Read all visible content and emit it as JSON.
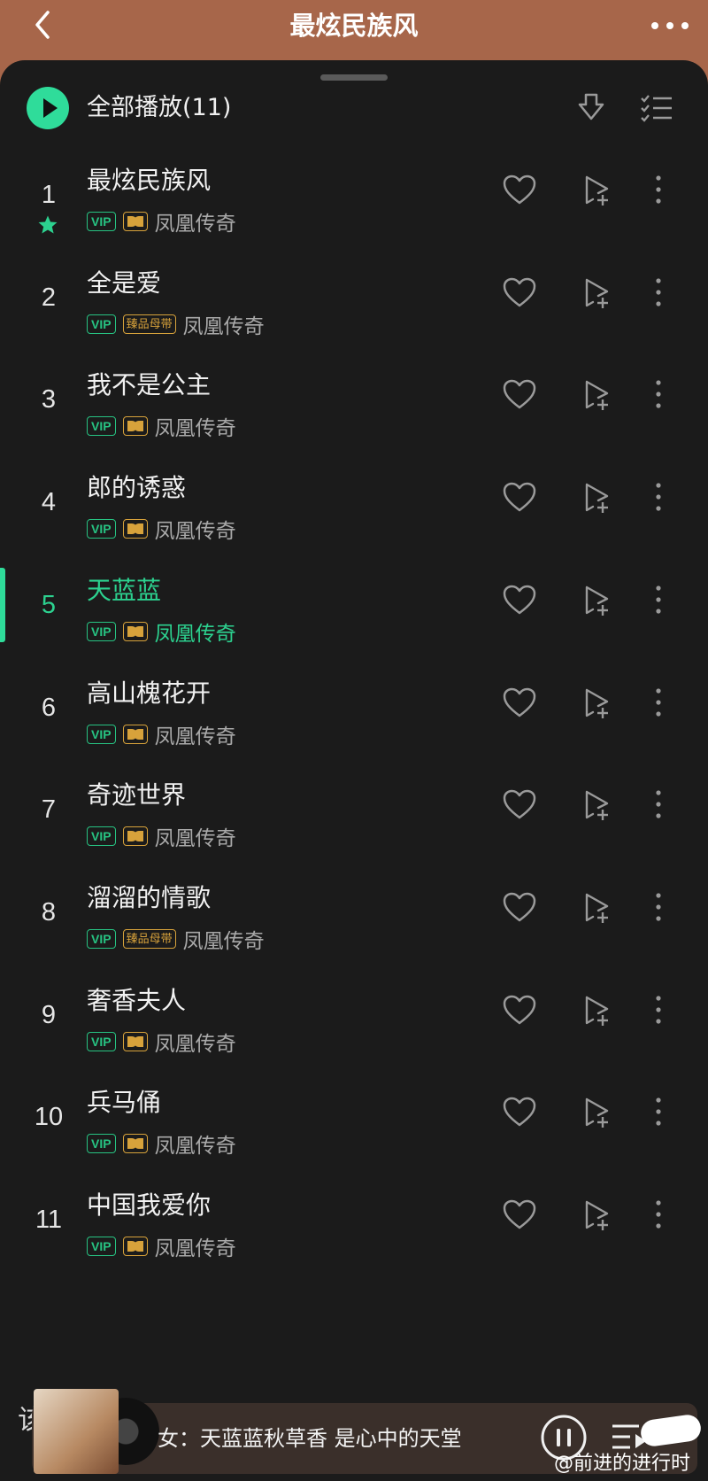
{
  "header": {
    "title": "最炫民族风",
    "bg_color": "#a7664a",
    "back_icon": "chevron-left-icon",
    "more_icon": "more-horizontal-icon"
  },
  "toolbar": {
    "play_all_label": "全部播放(11)",
    "accent_color": "#2fdc9a",
    "download_icon": "download-icon",
    "multiselect_icon": "checklist-icon"
  },
  "songs": [
    {
      "num": "1",
      "title": "最炫民族风",
      "badges": [
        "VIP",
        "dolby"
      ],
      "artist": "凤凰传奇",
      "starred": true,
      "active": false
    },
    {
      "num": "2",
      "title": "全是爱",
      "badges": [
        "VIP",
        "臻品母带"
      ],
      "artist": "凤凰传奇",
      "starred": false,
      "active": false
    },
    {
      "num": "3",
      "title": "我不是公主",
      "badges": [
        "VIP",
        "dolby"
      ],
      "artist": "凤凰传奇",
      "starred": false,
      "active": false
    },
    {
      "num": "4",
      "title": "郎的诱惑",
      "badges": [
        "VIP",
        "dolby"
      ],
      "artist": "凤凰传奇",
      "starred": false,
      "active": false
    },
    {
      "num": "5",
      "title": "天蓝蓝",
      "badges": [
        "VIP",
        "dolby"
      ],
      "artist": "凤凰传奇",
      "starred": false,
      "active": true
    },
    {
      "num": "6",
      "title": "高山槐花开",
      "badges": [
        "VIP",
        "dolby"
      ],
      "artist": "凤凰传奇",
      "starred": false,
      "active": false
    },
    {
      "num": "7",
      "title": "奇迹世界",
      "badges": [
        "VIP",
        "dolby"
      ],
      "artist": "凤凰传奇",
      "starred": false,
      "active": false
    },
    {
      "num": "8",
      "title": "溜溜的情歌",
      "badges": [
        "VIP",
        "臻品母带"
      ],
      "artist": "凤凰传奇",
      "starred": false,
      "active": false
    },
    {
      "num": "9",
      "title": "奢香夫人",
      "badges": [
        "VIP",
        "dolby"
      ],
      "artist": "凤凰传奇",
      "starred": false,
      "active": false
    },
    {
      "num": "10",
      "title": "兵马俑",
      "badges": [
        "VIP",
        "dolby"
      ],
      "artist": "凤凰传奇",
      "starred": false,
      "active": false
    },
    {
      "num": "11",
      "title": "中国我爱你",
      "badges": [
        "VIP",
        "dolby"
      ],
      "artist": "凤凰传奇",
      "starred": false,
      "active": false
    }
  ],
  "row_icons": {
    "favorite": "heart-icon",
    "add_to_playlist": "add-to-playlist-icon",
    "more": "more-vertical-icon"
  },
  "mini_player": {
    "hidden_text": "该",
    "lyric": "女：天蓝蓝秋草香 是心中的天堂",
    "pause_icon": "pause-icon",
    "playlist_icon": "playlist-icon"
  },
  "watermark": {
    "logo_text": "HUPU",
    "text": "@前进的进行时"
  }
}
